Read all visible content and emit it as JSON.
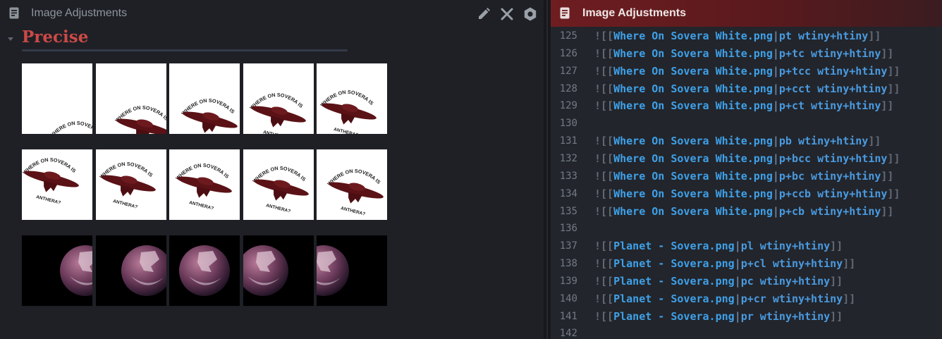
{
  "left": {
    "title": "Image Adjustments",
    "heading": "Precise",
    "rows": [
      {
        "kind": "ufo-white",
        "count": 5
      },
      {
        "kind": "ufo-white",
        "count": 5
      },
      {
        "kind": "planet-black",
        "count": 5
      }
    ],
    "icons": [
      "document-icon",
      "pencil-icon",
      "close-icon",
      "gear-icon",
      "chevron-down-icon"
    ]
  },
  "ufo_text": {
    "top": "WHERE ON SOVERA IS",
    "bottom": "ANTHERA?"
  },
  "right": {
    "title": "Image Adjustments",
    "lines": [
      {
        "num": "125",
        "pre": "![[",
        "file": "Where On Sovera White.png",
        "alias": "pt wtiny+htiny",
        "post": "]]"
      },
      {
        "num": "126",
        "pre": "![[",
        "file": "Where On Sovera White.png",
        "alias": "p+tc wtiny+htiny",
        "post": "]]"
      },
      {
        "num": "127",
        "pre": "![[",
        "file": "Where On Sovera White.png",
        "alias": "p+tcc wtiny+htiny",
        "post": "]]"
      },
      {
        "num": "128",
        "pre": "![[",
        "file": "Where On Sovera White.png",
        "alias": "p+cct wtiny+htiny",
        "post": "]]"
      },
      {
        "num": "129",
        "pre": "![[",
        "file": "Where On Sovera White.png",
        "alias": "p+ct wtiny+htiny",
        "post": "]]"
      },
      {
        "num": "130",
        "pre": "",
        "file": "",
        "alias": "",
        "post": ""
      },
      {
        "num": "131",
        "pre": "![[",
        "file": "Where On Sovera White.png",
        "alias": "pb wtiny+htiny",
        "post": "]]"
      },
      {
        "num": "132",
        "pre": "![[",
        "file": "Where On Sovera White.png",
        "alias": "p+bcc wtiny+htiny",
        "post": "]]"
      },
      {
        "num": "133",
        "pre": "![[",
        "file": "Where On Sovera White.png",
        "alias": "p+bc wtiny+htiny",
        "post": "]]"
      },
      {
        "num": "134",
        "pre": "![[",
        "file": "Where On Sovera White.png",
        "alias": "p+ccb wtiny+htiny",
        "post": "]]"
      },
      {
        "num": "135",
        "pre": "![[",
        "file": "Where On Sovera White.png",
        "alias": "p+cb wtiny+htiny",
        "post": "]]"
      },
      {
        "num": "136",
        "pre": "",
        "file": "",
        "alias": "",
        "post": ""
      },
      {
        "num": "137",
        "pre": "![[",
        "file": "Planet - Sovera.png",
        "alias": "pl wtiny+htiny",
        "post": "]]"
      },
      {
        "num": "138",
        "pre": "![[",
        "file": "Planet - Sovera.png",
        "alias": "p+cl wtiny+htiny",
        "post": "]]"
      },
      {
        "num": "139",
        "pre": "![[",
        "file": "Planet - Sovera.png",
        "alias": "pc wtiny+htiny",
        "post": "]]"
      },
      {
        "num": "140",
        "pre": "![[",
        "file": "Planet - Sovera.png",
        "alias": "p+cr wtiny+htiny",
        "post": "]]"
      },
      {
        "num": "141",
        "pre": "![[",
        "file": "Planet - Sovera.png",
        "alias": "pr wtiny+htiny",
        "post": "]]"
      },
      {
        "num": "142",
        "pre": "",
        "file": "",
        "alias": "",
        "post": ""
      }
    ]
  },
  "colors": {
    "heading": "#cc4a46",
    "link": "#3fa0e8",
    "header_active": "#6e1d20"
  }
}
